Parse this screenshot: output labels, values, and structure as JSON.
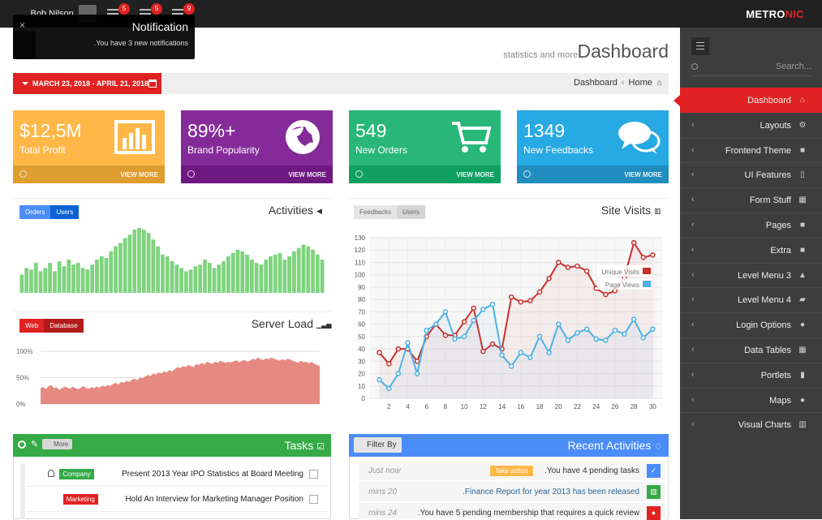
{
  "topbar": {
    "user": "Bob Nilson",
    "badges": [
      "5",
      "5",
      "9"
    ],
    "logo_a": "METRO",
    "logo_b": "NIC"
  },
  "notification": {
    "title": "Notification",
    "message": ".You have 3 new notifications",
    "close": "×"
  },
  "sidebar": {
    "search_placeholder": "Search...",
    "items": [
      {
        "label": "Dashboard",
        "icon": "home-icon",
        "glyph": "⌂"
      },
      {
        "label": "Layouts",
        "icon": "cogs-icon",
        "glyph": "⚙"
      },
      {
        "label": "Frontend Theme",
        "icon": "gift-icon",
        "glyph": "■"
      },
      {
        "label": "UI Features",
        "icon": "bookmark-icon",
        "glyph": "▯"
      },
      {
        "label": "Form Stuff",
        "icon": "table-icon",
        "glyph": "▦"
      },
      {
        "label": "Pages",
        "icon": "briefcase-icon",
        "glyph": "■"
      },
      {
        "label": "Extra",
        "icon": "gift-icon",
        "glyph": "■"
      },
      {
        "label": "Level Menu 3",
        "icon": "sitemap-icon",
        "glyph": "▲"
      },
      {
        "label": "Level Menu 4",
        "icon": "folder-open-icon",
        "glyph": "▰"
      },
      {
        "label": "Login Options",
        "icon": "user-icon",
        "glyph": "●"
      },
      {
        "label": "Data Tables",
        "icon": "th-icon",
        "glyph": "▦"
      },
      {
        "label": "Portlets",
        "icon": "file-icon",
        "glyph": "▮"
      },
      {
        "label": "Maps",
        "icon": "map-marker-icon",
        "glyph": "●"
      },
      {
        "label": "Visual Charts",
        "icon": "bar-chart-icon",
        "glyph": "▥"
      }
    ]
  },
  "page": {
    "title": "Dashboard",
    "subtitle": "statistics and more",
    "date_range": "MARCH 23, 2018 - APRIL 21, 2018",
    "breadcrumb": [
      "Home",
      "Dashboard"
    ]
  },
  "tiles": [
    {
      "value": "$12,5M",
      "label": "Total Profit",
      "more": "VIEW MORE",
      "color": "#ffb848",
      "foot": "#dd9d2f",
      "icon": "bar-chart-icon"
    },
    {
      "value": "89%+",
      "label": "Brand Popularity",
      "more": "VIEW MORE",
      "color": "#852b99",
      "foot": "#6e1881",
      "icon": "globe-icon"
    },
    {
      "value": "549",
      "label": "New Orders",
      "more": "VIEW MORE",
      "color": "#28b779",
      "foot": "#10a062",
      "icon": "shopping-cart-icon"
    },
    {
      "value": "1349",
      "label": "New Feedbacks",
      "more": "VIEW MORE",
      "color": "#27a9e3",
      "foot": "#208dbe",
      "icon": "comments-icon"
    }
  ],
  "activities": {
    "title": "Activities",
    "tabs": [
      "Orders",
      "Users"
    ]
  },
  "server_load": {
    "title": "Server Load",
    "tabs": [
      "Web",
      "Database"
    ],
    "y_ticks": [
      "100%",
      "50%",
      "0%"
    ]
  },
  "site_visits": {
    "title": "Site Visits",
    "tabs": [
      "Feedbacks",
      "Users"
    ]
  },
  "tasks": {
    "title": "Tasks",
    "more": "More",
    "rows": [
      {
        "label": "Company",
        "label_color": "#35aa47",
        "text": "Present 2013 Year IPO Statistics at Board Meeting",
        "bell": true
      },
      {
        "label": "Marketing",
        "label_color": "#e02222",
        "text": "Hold An Interview for Marketing Manager Position",
        "bell": false
      }
    ]
  },
  "recent": {
    "title": "Recent Activities",
    "filter": "Filter By",
    "rows": [
      {
        "time": "Just now",
        "text": ".You have 4 pending tasks",
        "button": "Take action",
        "icon": "check-icon",
        "glyph": "✓",
        "color": "#4b8df8"
      },
      {
        "time": "mins 20",
        "text": ".Finance Report for year 2013 has been released",
        "button": "",
        "icon": "bar-chart-icon",
        "glyph": "▥",
        "color": "#35aa47"
      },
      {
        "time": "mins 24",
        "text": ".You have 5 pending membership that requires a quick review",
        "button": "",
        "icon": "user-icon",
        "glyph": "●",
        "color": "#e02222"
      }
    ]
  },
  "chart_data": [
    {
      "type": "bar",
      "title": "Activities",
      "values": [
        22,
        30,
        28,
        36,
        26,
        30,
        36,
        26,
        38,
        32,
        40,
        34,
        36,
        30,
        28,
        34,
        40,
        44,
        42,
        50,
        56,
        60,
        66,
        70,
        76,
        78,
        76,
        72,
        64,
        56,
        46,
        44,
        38,
        34,
        30,
        26,
        28,
        32,
        34,
        40,
        36,
        30,
        34,
        38,
        44,
        48,
        52,
        50,
        46,
        40,
        36,
        34,
        40,
        44,
        46,
        48,
        40,
        44,
        50,
        54,
        58,
        56,
        52,
        46,
        40
      ],
      "color": "#7fd37f"
    },
    {
      "type": "area",
      "title": "Server Load",
      "y_ticks": [
        "100%",
        "50%",
        "0%"
      ],
      "ylim": [
        0,
        100
      ],
      "values": [
        30,
        32,
        28,
        34,
        36,
        30,
        32,
        27,
        30,
        33,
        31,
        29,
        33,
        30,
        28,
        31,
        34,
        30,
        29,
        32,
        30,
        33,
        31,
        35,
        33,
        36,
        34,
        38,
        40,
        37,
        42,
        40,
        44,
        42,
        46,
        48,
        45,
        50,
        49,
        52,
        55,
        53,
        58,
        56,
        60,
        58,
        62,
        60,
        64,
        62,
        66,
        70,
        68,
        72,
        70,
        74,
        72,
        70,
        76,
        74,
        78,
        75,
        80,
        78,
        76,
        80,
        78,
        82,
        80,
        78,
        80,
        79,
        81,
        83,
        79,
        82,
        84,
        80,
        82,
        86,
        84,
        88,
        85,
        83,
        87,
        85,
        88,
        86,
        84,
        82,
        85,
        83,
        86,
        84,
        82,
        80,
        78,
        82,
        79,
        80,
        77,
        80,
        76,
        74,
        72
      ],
      "color": "#e2746b"
    },
    {
      "type": "line",
      "title": "Site Visits",
      "x": [
        1,
        2,
        3,
        4,
        5,
        6,
        7,
        8,
        9,
        10,
        11,
        12,
        13,
        14,
        15,
        16,
        17,
        18,
        19,
        20,
        21,
        22,
        23,
        24,
        25,
        26,
        27,
        28,
        29,
        30
      ],
      "x_ticks": [
        2,
        4,
        6,
        8,
        10,
        12,
        14,
        16,
        18,
        20,
        22,
        24,
        26,
        28,
        30
      ],
      "y_ticks": [
        0,
        10,
        20,
        30,
        40,
        50,
        60,
        70,
        80,
        90,
        100,
        110,
        120,
        130
      ],
      "ylim": [
        0,
        130
      ],
      "xlim": [
        0,
        31
      ],
      "series": [
        {
          "name": "Unique Visits",
          "color": "#c9302c",
          "values": [
            37,
            28,
            40,
            40,
            30,
            50,
            60,
            51,
            51,
            62,
            73,
            38,
            44,
            40,
            82,
            78,
            79,
            86,
            97,
            110,
            106,
            107,
            103,
            89,
            84,
            87,
            98,
            126,
            114,
            116
          ]
        },
        {
          "name": "Page Views",
          "color": "#4bb2e6",
          "values": [
            15,
            8,
            20,
            45,
            20,
            55,
            60,
            70,
            48,
            50,
            63,
            72,
            76,
            35,
            26,
            37,
            33,
            50,
            37,
            60,
            47,
            53,
            56,
            48,
            47,
            55,
            52,
            64,
            49,
            56
          ]
        }
      ]
    }
  ]
}
